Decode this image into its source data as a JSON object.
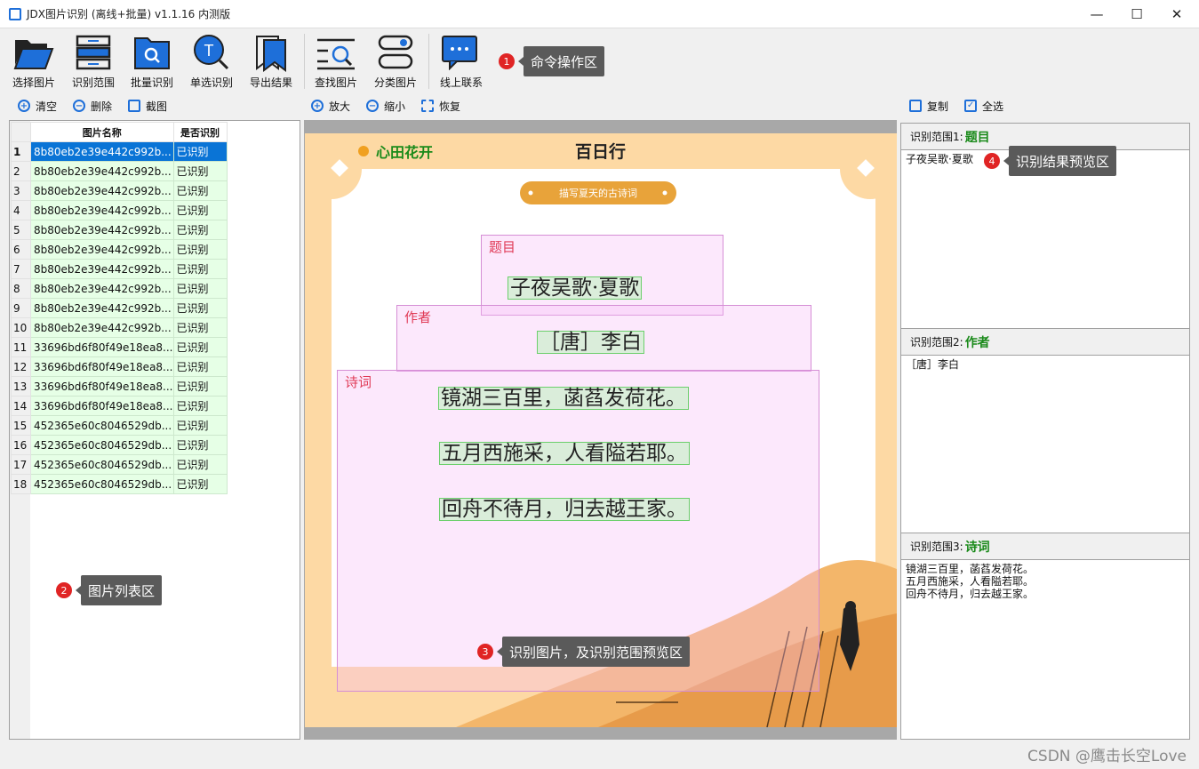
{
  "window": {
    "title": "JDX图片识别 (离线+批量) v1.1.16 内测版",
    "min": "—",
    "max": "☐",
    "close": "✕"
  },
  "toolbar": {
    "buttons": [
      "选择图片",
      "识别范围",
      "批量识别",
      "单选识别",
      "导出结果",
      "查找图片",
      "分类图片",
      "线上联系"
    ]
  },
  "callouts": [
    {
      "num": "1",
      "text": "命令操作区"
    },
    {
      "num": "2",
      "text": "图片列表区"
    },
    {
      "num": "3",
      "text": "识别图片，及识别范围预览区"
    },
    {
      "num": "4",
      "text": "识别结果预览区"
    }
  ],
  "left_actions": {
    "clear": "清空",
    "delete": "删除",
    "screenshot": "截图"
  },
  "view_actions": {
    "zoom_in": "放大",
    "zoom_out": "缩小",
    "restore": "恢复"
  },
  "right_actions": {
    "copy": "复制",
    "select_all": "全选"
  },
  "list": {
    "headers": [
      "图片名称",
      "是否识别"
    ],
    "rows": [
      {
        "n": "1",
        "name": "8b80eb2e39e442c992b...",
        "status": "已识别"
      },
      {
        "n": "2",
        "name": "8b80eb2e39e442c992b...",
        "status": "已识别"
      },
      {
        "n": "3",
        "name": "8b80eb2e39e442c992b...",
        "status": "已识别"
      },
      {
        "n": "4",
        "name": "8b80eb2e39e442c992b...",
        "status": "已识别"
      },
      {
        "n": "5",
        "name": "8b80eb2e39e442c992b...",
        "status": "已识别"
      },
      {
        "n": "6",
        "name": "8b80eb2e39e442c992b...",
        "status": "已识别"
      },
      {
        "n": "7",
        "name": "8b80eb2e39e442c992b...",
        "status": "已识别"
      },
      {
        "n": "8",
        "name": "8b80eb2e39e442c992b...",
        "status": "已识别"
      },
      {
        "n": "9",
        "name": "8b80eb2e39e442c992b...",
        "status": "已识别"
      },
      {
        "n": "10",
        "name": "8b80eb2e39e442c992b...",
        "status": "已识别"
      },
      {
        "n": "11",
        "name": "33696bd6f80f49e18ea8...",
        "status": "已识别"
      },
      {
        "n": "12",
        "name": "33696bd6f80f49e18ea8...",
        "status": "已识别"
      },
      {
        "n": "13",
        "name": "33696bd6f80f49e18ea8...",
        "status": "已识别"
      },
      {
        "n": "14",
        "name": "33696bd6f80f49e18ea8...",
        "status": "已识别"
      },
      {
        "n": "15",
        "name": "452365e60c8046529db...",
        "status": "已识别"
      },
      {
        "n": "16",
        "name": "452365e60c8046529db...",
        "status": "已识别"
      },
      {
        "n": "17",
        "name": "452365e60c8046529db...",
        "status": "已识别"
      },
      {
        "n": "18",
        "name": "452365e60c8046529db...",
        "status": "已识别"
      }
    ]
  },
  "image": {
    "brand": "心田花开",
    "logo": "百日行",
    "banner": "描写夏天的古诗词",
    "regions": [
      "题目",
      "作者",
      "诗词"
    ],
    "lines": [
      "子夜吴歌·夏歌",
      "［唐］李白",
      "镜湖三百里，菡萏发荷花。",
      "五月西施采，人看隘若耶。",
      "回舟不待月，归去越王家。"
    ]
  },
  "results": [
    {
      "label": "识别范围1:",
      "name": "题目",
      "text": "子夜吴歌·夏歌"
    },
    {
      "label": "识别范围2:",
      "name": "作者",
      "text": "［唐］李白"
    },
    {
      "label": "识别范围3:",
      "name": "诗词",
      "text": "镜湖三百里，菡萏发荷花。\n五月西施采，人看隘若耶。\n回舟不待月，归去越王家。"
    }
  ],
  "watermark": "CSDN @鹰击长空Love"
}
